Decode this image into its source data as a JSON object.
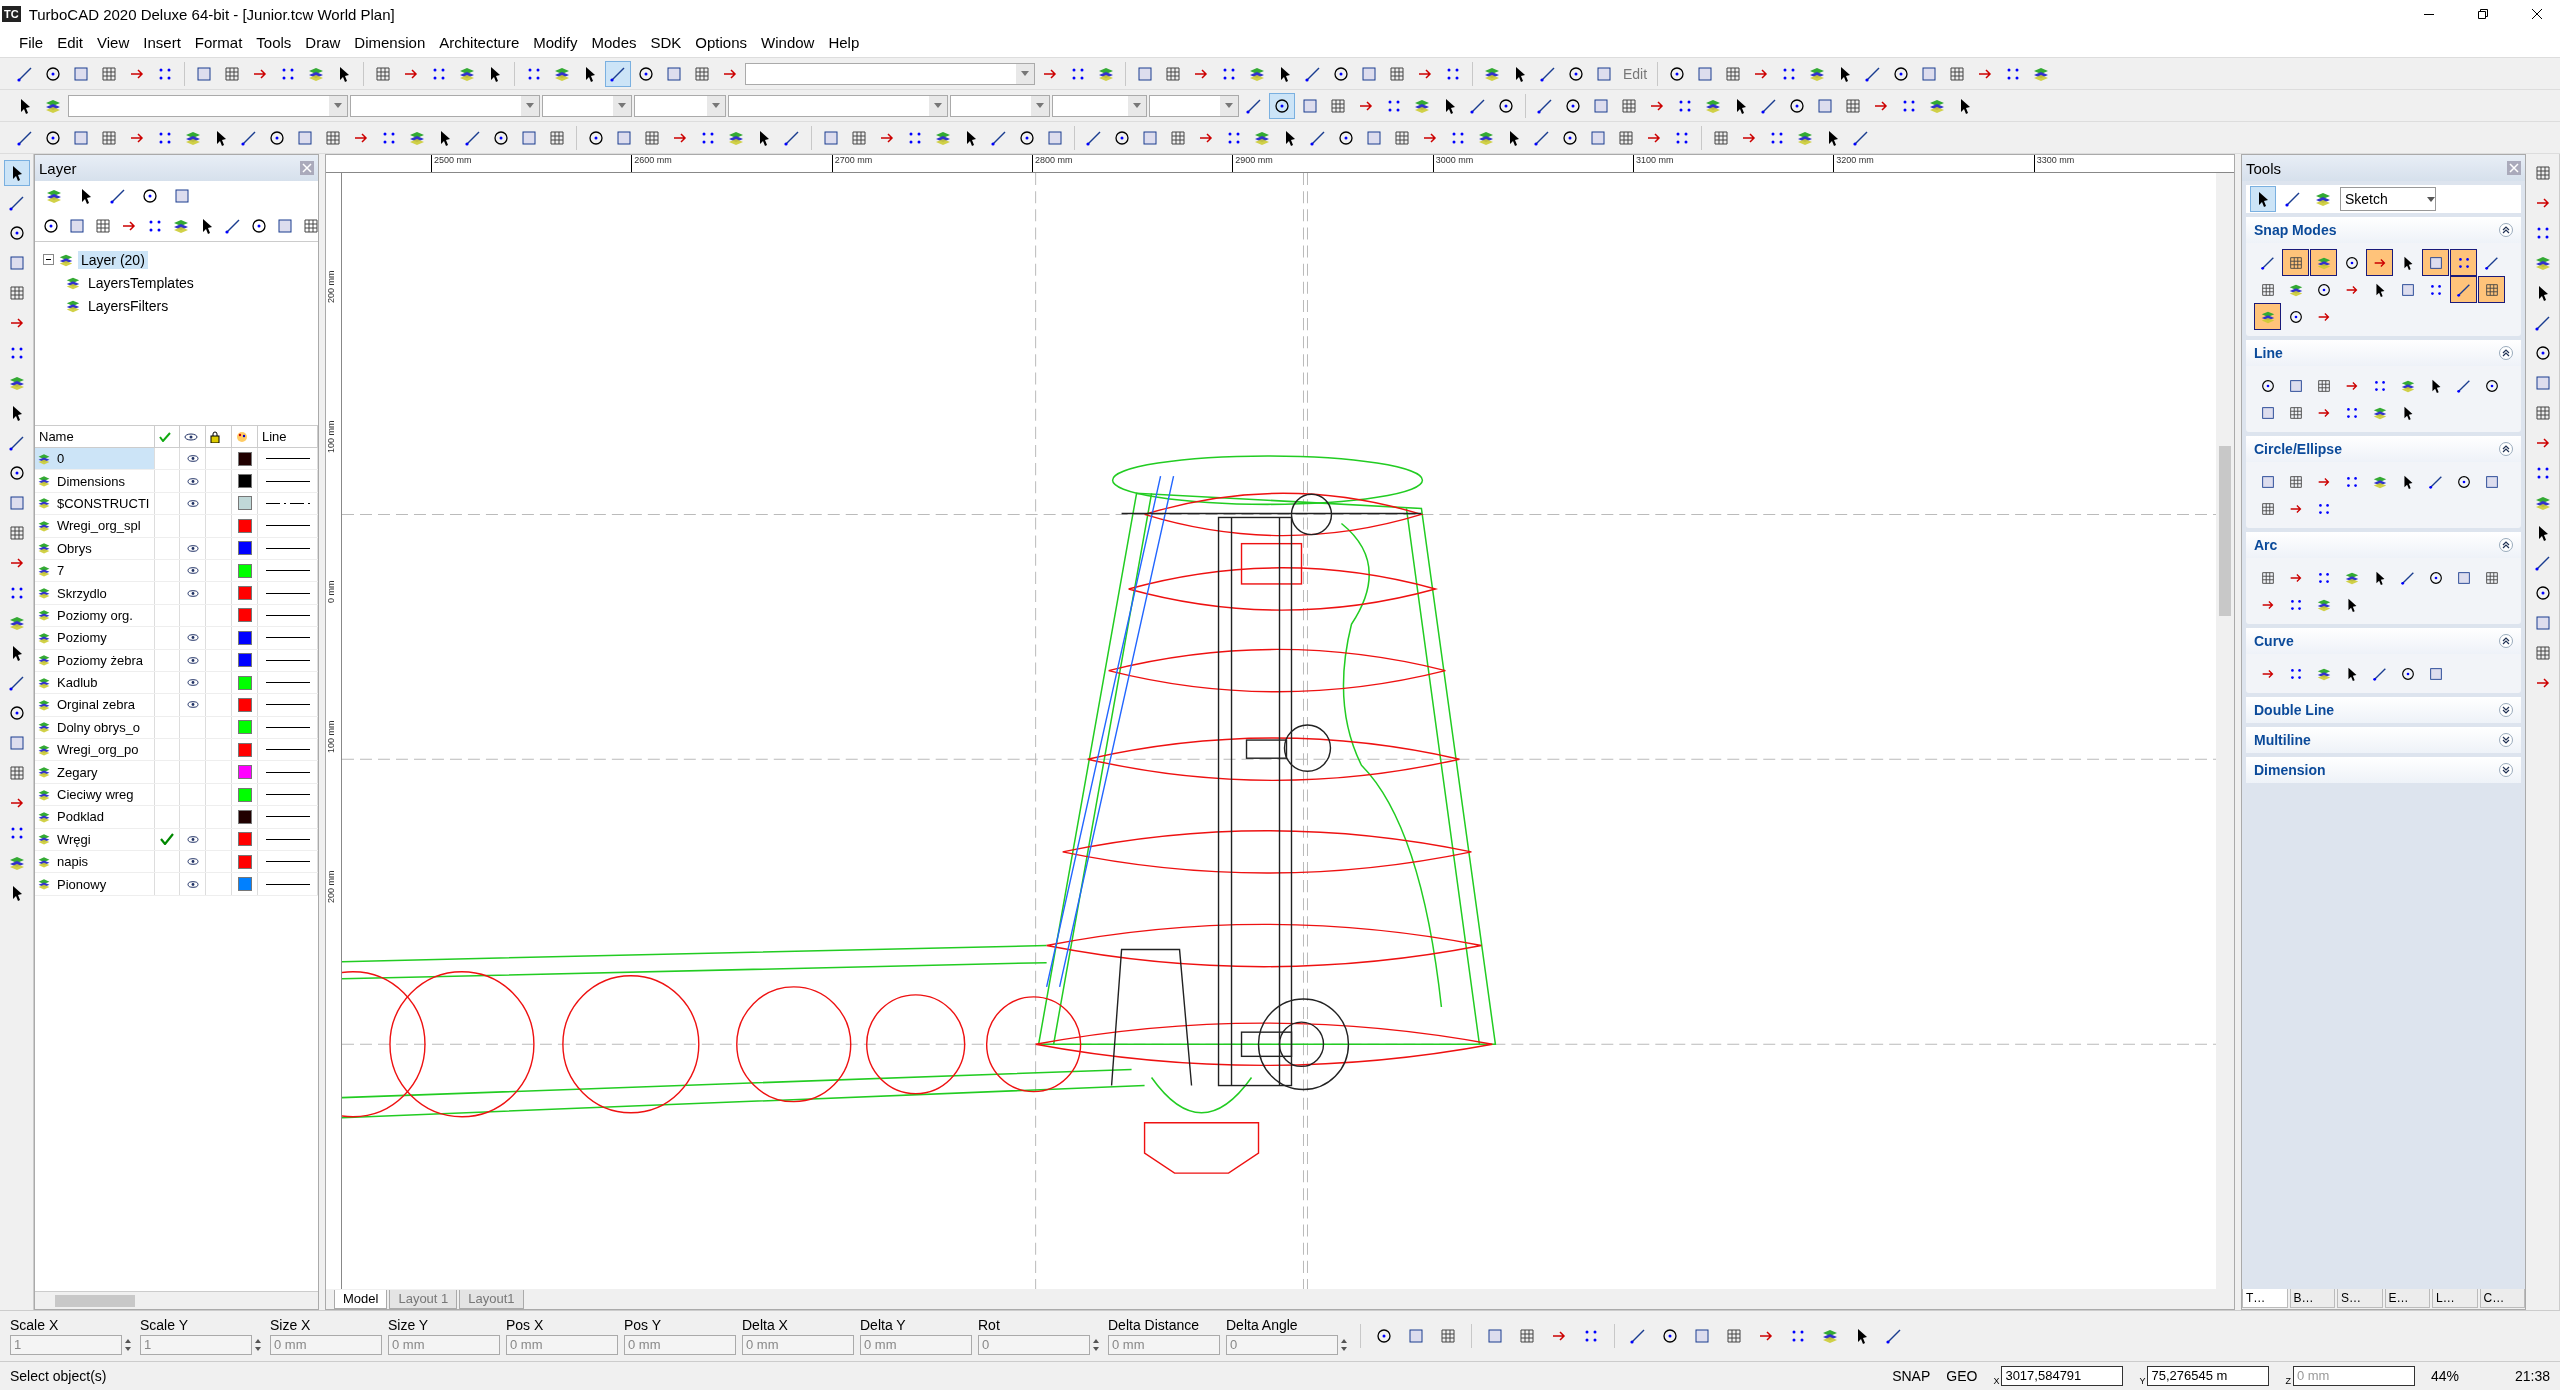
{
  "title_bar": {
    "badge": "TC",
    "title": "TurboCAD 2020 Deluxe 64-bit - [Junior.tcw World Plan]"
  },
  "menu": [
    "File",
    "Edit",
    "View",
    "Insert",
    "Format",
    "Tools",
    "Draw",
    "Dimension",
    "Architecture",
    "Modify",
    "Modes",
    "SDK",
    "Options",
    "Window",
    "Help"
  ],
  "toolbar": {
    "edit_label": "Edit"
  },
  "layer_panel": {
    "title": "Layer",
    "tree": {
      "label": "Layer (20)",
      "selected": true,
      "expanded": true,
      "children": [
        {
          "label": "LayersTemplates"
        },
        {
          "label": "LayersFilters"
        }
      ]
    },
    "columns": [
      "Name",
      "Line"
    ],
    "rows": [
      {
        "name": "0",
        "selected": true,
        "current": false,
        "visible": true,
        "color": "#200000",
        "dash_dot": false
      },
      {
        "name": "Dimensions",
        "selected": false,
        "current": false,
        "visible": true,
        "color": "#000000",
        "dash_dot": false
      },
      {
        "name": "$CONSTRUCTI",
        "selected": false,
        "current": false,
        "visible": true,
        "color": "#c0d8d8",
        "dash_dot": true
      },
      {
        "name": "Wregi_org_spl",
        "selected": false,
        "current": false,
        "visible": false,
        "color": "#ff0000",
        "dash_dot": false
      },
      {
        "name": "Obrys",
        "selected": false,
        "current": false,
        "visible": true,
        "color": "#0000ff",
        "dash_dot": false
      },
      {
        "name": "7",
        "selected": false,
        "current": false,
        "visible": true,
        "color": "#00ff00",
        "dash_dot": false
      },
      {
        "name": "Skrzydlo",
        "selected": false,
        "current": false,
        "visible": true,
        "color": "#ff0000",
        "dash_dot": false
      },
      {
        "name": "Poziomy org.",
        "selected": false,
        "current": false,
        "visible": false,
        "color": "#ff0000",
        "dash_dot": false
      },
      {
        "name": "Poziomy",
        "selected": false,
        "current": false,
        "visible": true,
        "color": "#0000ff",
        "dash_dot": false
      },
      {
        "name": "Poziomy żebra",
        "selected": false,
        "current": false,
        "visible": true,
        "color": "#0000ff",
        "dash_dot": false
      },
      {
        "name": "Kadlub",
        "selected": false,
        "current": false,
        "visible": true,
        "color": "#00ff00",
        "dash_dot": false
      },
      {
        "name": "Orginal zebra",
        "selected": false,
        "current": false,
        "visible": true,
        "color": "#ff0000",
        "dash_dot": false
      },
      {
        "name": "Dolny obrys_o",
        "selected": false,
        "current": false,
        "visible": false,
        "color": "#00ff00",
        "dash_dot": false
      },
      {
        "name": "Wregi_org_po",
        "selected": false,
        "current": false,
        "visible": false,
        "color": "#ff0000",
        "dash_dot": false
      },
      {
        "name": "Zegary",
        "selected": false,
        "current": false,
        "visible": false,
        "color": "#ff00ff",
        "dash_dot": false
      },
      {
        "name": "Cieciwy wreg",
        "selected": false,
        "current": false,
        "visible": false,
        "color": "#00ff00",
        "dash_dot": false
      },
      {
        "name": "Podklad",
        "selected": false,
        "current": false,
        "visible": false,
        "color": "#200000",
        "dash_dot": false
      },
      {
        "name": "Wręgi",
        "selected": false,
        "current": true,
        "visible": true,
        "color": "#ff0000",
        "dash_dot": false
      },
      {
        "name": "napis",
        "selected": false,
        "current": false,
        "visible": true,
        "color": "#ff0000",
        "dash_dot": false
      },
      {
        "name": "Pionowy",
        "selected": false,
        "current": false,
        "visible": true,
        "color": "#0080ff",
        "dash_dot": false
      }
    ]
  },
  "canvas": {
    "ruler_x": [
      "2500 mm",
      "2600 mm",
      "2700 mm",
      "2800 mm",
      "2900 mm",
      "3000 mm",
      "3100 mm",
      "3200 mm",
      "3300 mm"
    ],
    "ruler_y": [
      "200 mm",
      "100 mm",
      "0 mm",
      "100 mm",
      "200 mm"
    ],
    "tabs": [
      {
        "label": "Model",
        "selected": true
      },
      {
        "label": "Layout 1",
        "selected": false
      },
      {
        "label": "Layout1",
        "selected": false
      }
    ]
  },
  "tools_panel": {
    "title": "Tools",
    "mode": "Sketch",
    "snap_modes": [
      {
        "on": false
      },
      {
        "on": true
      },
      {
        "on": true
      },
      {
        "on": false
      },
      {
        "on": true
      },
      {
        "on": false
      },
      {
        "on": true
      },
      {
        "on": true
      },
      {
        "on": false
      },
      {
        "on": false
      },
      {
        "on": false
      },
      {
        "on": false
      },
      {
        "on": false
      },
      {
        "on": false
      },
      {
        "on": false
      },
      {
        "on": false
      },
      {
        "on": true
      },
      {
        "on": true
      },
      {
        "on": true
      },
      {
        "on": false
      },
      {
        "on": false
      }
    ],
    "sections": [
      {
        "title": "Snap Modes",
        "kind": "snap",
        "expanded": true
      },
      {
        "title": "Line",
        "kind": "line",
        "expanded": true
      },
      {
        "title": "Circle/Ellipse",
        "kind": "circle",
        "expanded": true
      },
      {
        "title": "Arc",
        "kind": "arc",
        "expanded": true
      },
      {
        "title": "Curve",
        "kind": "curve",
        "expanded": true
      },
      {
        "title": "Double Line",
        "expanded": false
      },
      {
        "title": "Multiline",
        "expanded": false
      },
      {
        "title": "Dimension",
        "expanded": false
      }
    ]
  },
  "palette_tabs": [
    {
      "label": "T…",
      "selected": true
    },
    {
      "label": "B…",
      "selected": false
    },
    {
      "label": "S…",
      "selected": false
    },
    {
      "label": "E…",
      "selected": false
    },
    {
      "label": "L…",
      "selected": false
    },
    {
      "label": "C…",
      "selected": false
    }
  ],
  "properties": [
    {
      "label": "Scale X",
      "placeholder": "1",
      "kind": "spin"
    },
    {
      "label": "Scale Y",
      "placeholder": "1",
      "kind": "spin"
    },
    {
      "label": "Size X",
      "placeholder": "0 mm",
      "kind": "plain"
    },
    {
      "label": "Size Y",
      "placeholder": "0 mm",
      "kind": "plain"
    },
    {
      "label": "Pos X",
      "placeholder": "0 mm",
      "kind": "plain"
    },
    {
      "label": "Pos Y",
      "placeholder": "0 mm",
      "kind": "plain"
    },
    {
      "label": "Delta X",
      "placeholder": "0 mm",
      "kind": "plain"
    },
    {
      "label": "Delta Y",
      "placeholder": "0 mm",
      "kind": "plain"
    },
    {
      "label": "Rot",
      "placeholder": "0",
      "kind": "spin"
    },
    {
      "label": "Delta Distance",
      "placeholder": "0 mm",
      "kind": "plain"
    },
    {
      "label": "Delta Angle",
      "placeholder": "0",
      "kind": "spin"
    }
  ],
  "status": {
    "message": "Select object(s)",
    "flags": [
      "SNAP",
      "GEO"
    ],
    "coords": [
      {
        "axis": "X",
        "value": "3017,584791"
      },
      {
        "axis": "Y",
        "value": "75,276545 m"
      },
      {
        "axis": "Z",
        "placeholder": "0 mm"
      }
    ],
    "zoom": "44%",
    "time": "21:38"
  }
}
